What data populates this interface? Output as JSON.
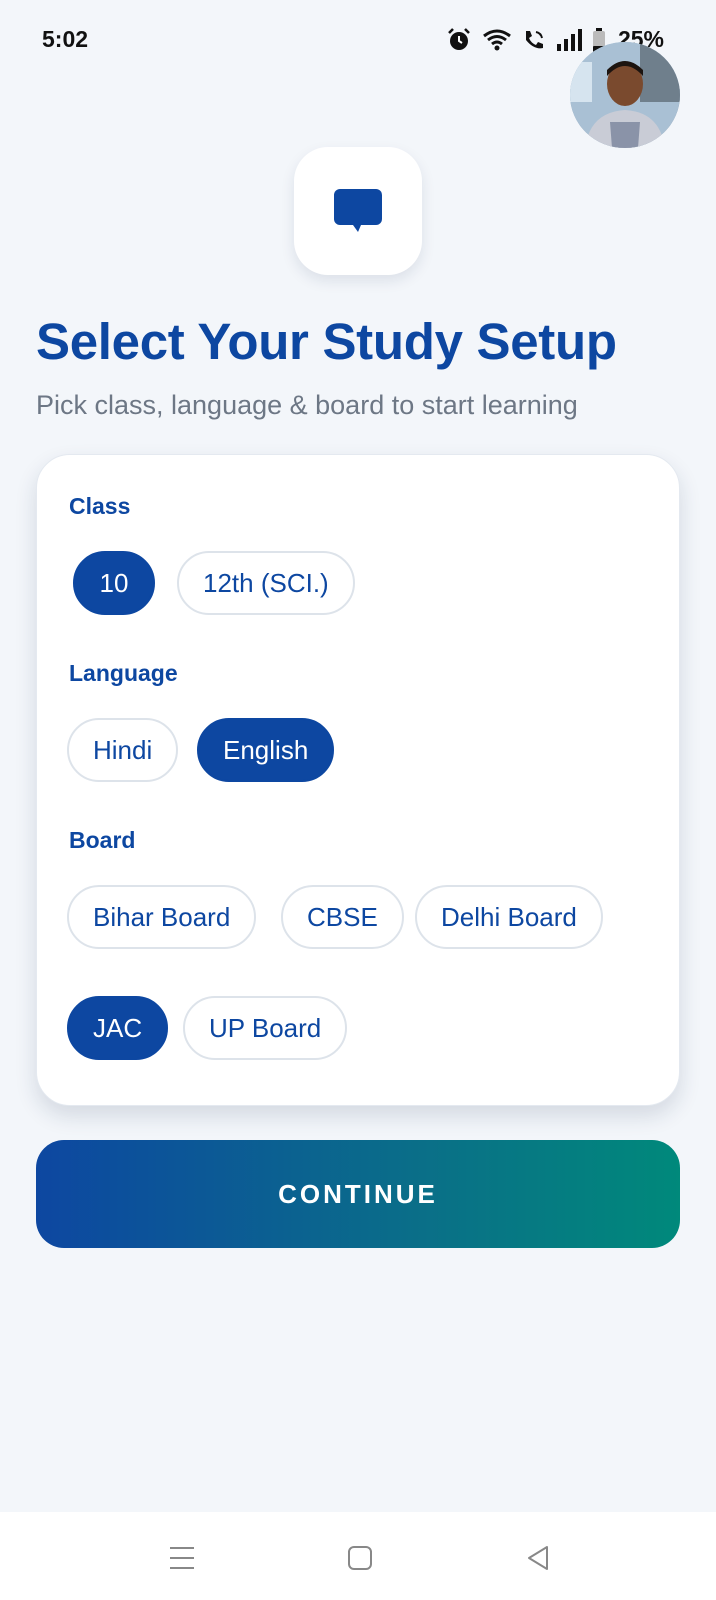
{
  "status_bar": {
    "time": "5:02",
    "battery": "25%",
    "icons": [
      "alarm-icon",
      "wifi-icon",
      "wifi-call-icon",
      "signal-icon",
      "battery-icon"
    ]
  },
  "header": {
    "logo_icon": "chat-bubble-icon",
    "title": "Select Your Study Setup",
    "subtitle": "Pick class, language & board to start learning"
  },
  "form": {
    "class": {
      "label": "Class",
      "options": [
        "10",
        "12th (SCI.)"
      ],
      "selected": "10"
    },
    "language": {
      "label": "Language",
      "options": [
        "Hindi",
        "English"
      ],
      "selected": "English"
    },
    "board": {
      "label": "Board",
      "options": [
        "Bihar Board",
        "CBSE",
        "Delhi Board",
        "JAC",
        "UP Board"
      ],
      "selected": "JAC"
    }
  },
  "actions": {
    "continue_label": "CONTINUE"
  },
  "nav_bar": {
    "icons": [
      "menu-icon",
      "home-icon",
      "back-icon"
    ]
  },
  "colors": {
    "primary": "#0d47a1",
    "accent": "#00897b",
    "background": "#f3f6fa",
    "subtitle": "#6d7785"
  }
}
